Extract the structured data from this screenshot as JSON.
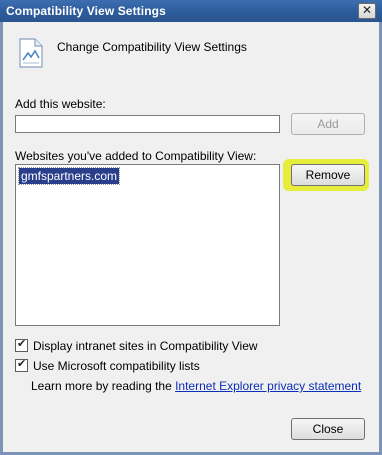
{
  "window": {
    "title": "Compatibility View Settings",
    "close_glyph": "✕"
  },
  "header": {
    "icon": "page-settings-icon",
    "title": "Change Compatibility View Settings"
  },
  "add_section": {
    "label": "Add this website:",
    "input_value": "",
    "add_label": "Add"
  },
  "list_section": {
    "label": "Websites you've added to Compatibility View:",
    "items": [
      "gmfspartners.com"
    ],
    "remove_label": "Remove",
    "highlight_color": "#e6ec30"
  },
  "options": {
    "intranet_label": "Display intranet sites in Compatibility View",
    "intranet_checked": true,
    "ms_lists_label": "Use Microsoft compatibility lists",
    "ms_lists_checked": true
  },
  "learn_more": {
    "prefix": "Learn more by reading the ",
    "link": "Internet Explorer privacy statement"
  },
  "footer": {
    "close_label": "Close"
  }
}
